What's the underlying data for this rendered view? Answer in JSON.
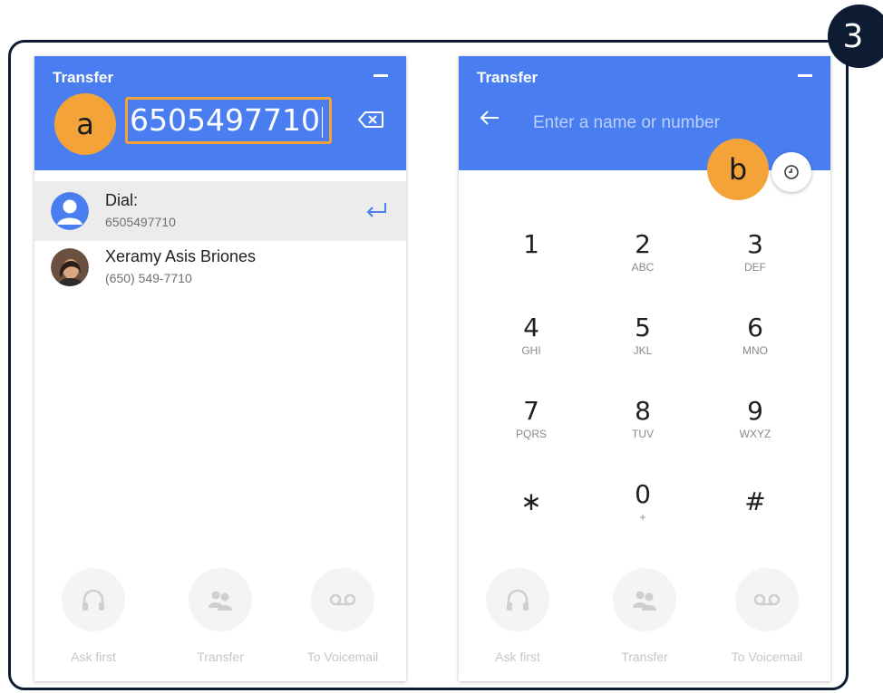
{
  "step_number": "3",
  "markers": {
    "a": "a",
    "b": "b"
  },
  "left_panel": {
    "title": "Transfer",
    "input_value": "6505497710",
    "dial_row": {
      "title": "Dial:",
      "number": "6505497710"
    },
    "contact_row": {
      "name": "Xeramy Asis Briones",
      "phone": "(650) 549-7710"
    },
    "actions": [
      {
        "label": "Ask first",
        "icon": "headphones-icon"
      },
      {
        "label": "Transfer",
        "icon": "transfer-people-icon"
      },
      {
        "label": "To Voicemail",
        "icon": "voicemail-icon"
      }
    ]
  },
  "right_panel": {
    "title": "Transfer",
    "search_placeholder": "Enter a name or number",
    "keypad": [
      {
        "digit": "1",
        "letters": ""
      },
      {
        "digit": "2",
        "letters": "ABC"
      },
      {
        "digit": "3",
        "letters": "DEF"
      },
      {
        "digit": "4",
        "letters": "GHI"
      },
      {
        "digit": "5",
        "letters": "JKL"
      },
      {
        "digit": "6",
        "letters": "MNO"
      },
      {
        "digit": "7",
        "letters": "PQRS"
      },
      {
        "digit": "8",
        "letters": "TUV"
      },
      {
        "digit": "9",
        "letters": "WXYZ"
      },
      {
        "digit": "∗",
        "letters": ""
      },
      {
        "digit": "0",
        "letters": "+"
      },
      {
        "digit": "#",
        "letters": ""
      }
    ],
    "actions": [
      {
        "label": "Ask first",
        "icon": "headphones-icon"
      },
      {
        "label": "Transfer",
        "icon": "transfer-people-icon"
      },
      {
        "label": "To Voicemail",
        "icon": "voicemail-icon"
      }
    ]
  },
  "colors": {
    "header_blue": "#4a7ef0",
    "marker_orange": "#f3a338",
    "frame_navy": "#0d1b33"
  }
}
